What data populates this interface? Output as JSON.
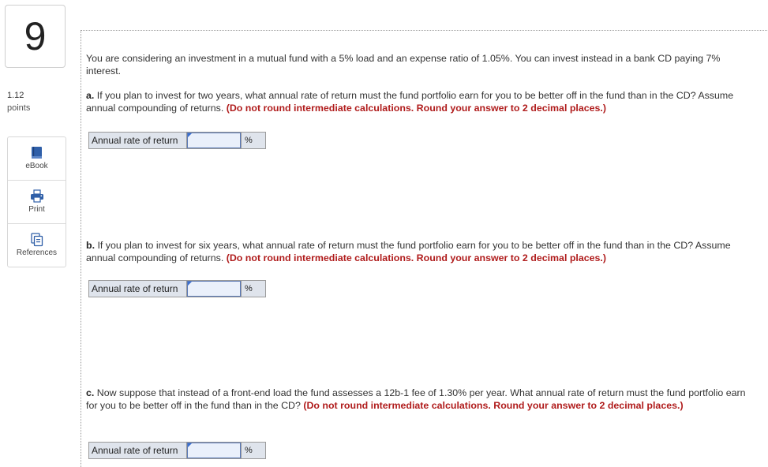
{
  "question": {
    "number": "9",
    "points_value": "1.12",
    "points_label": "points"
  },
  "tools": [
    {
      "label": "eBook",
      "icon": "book-icon"
    },
    {
      "label": "Print",
      "icon": "printer-icon"
    },
    {
      "label": "References",
      "icon": "documents-icon"
    }
  ],
  "intro": "You are considering an investment in a mutual fund with a 5% load and an expense ratio of 1.05%. You can invest instead in a bank CD paying 7% interest.",
  "parts": [
    {
      "letter": "a.",
      "text": " If you plan to invest for two years, what annual rate of return must the fund portfolio earn for you to be better off in the fund than in the CD? Assume annual compounding of returns. ",
      "instruction": "(Do not round intermediate calculations. Round your answer to 2 decimal places.)",
      "answer_label": "Annual rate of return",
      "answer_value": "",
      "unit": "%"
    },
    {
      "letter": "b.",
      "text": " If you plan to invest for six years, what annual rate of return must the fund portfolio earn for you to be better off in the fund than in the CD? Assume annual compounding of returns. ",
      "instruction": "(Do not round intermediate calculations. Round your answer to 2 decimal places.)",
      "answer_label": "Annual rate of return",
      "answer_value": "",
      "unit": "%"
    },
    {
      "letter": "c.",
      "text": " Now suppose that instead of a front-end load the fund assesses a 12b-1 fee of 1.30% per year. What annual rate of return must the fund portfolio earn for you to be better off in the fund than in the CD? ",
      "instruction": "(Do not round intermediate calculations. Round your answer to 2 decimal places.)",
      "answer_label": "Annual rate of return",
      "answer_value": "",
      "unit": "%"
    }
  ],
  "colors": {
    "instruction": "#b01c1c",
    "answer_label_bg": "#dfe4ec",
    "input_border": "#5b79b5",
    "icon_blue": "#2f5fa8"
  }
}
